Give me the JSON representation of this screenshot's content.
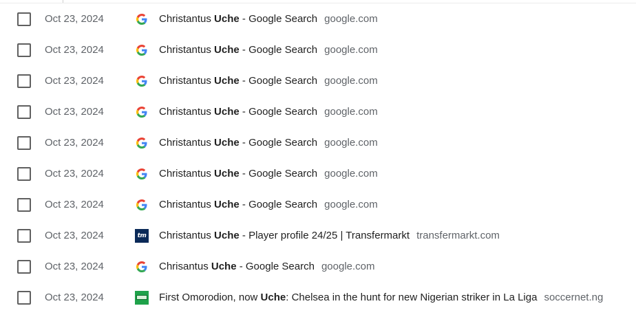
{
  "history": {
    "rows": [
      {
        "date": "Oct 23, 2024",
        "icon": "google-icon",
        "title_pre": "Christantus ",
        "title_hl": "Uche",
        "title_post": " - Google Search",
        "domain": "google.com"
      },
      {
        "date": "Oct 23, 2024",
        "icon": "google-icon",
        "title_pre": "Christantus ",
        "title_hl": "Uche",
        "title_post": " - Google Search",
        "domain": "google.com"
      },
      {
        "date": "Oct 23, 2024",
        "icon": "google-icon",
        "title_pre": "Christantus ",
        "title_hl": "Uche",
        "title_post": " - Google Search",
        "domain": "google.com"
      },
      {
        "date": "Oct 23, 2024",
        "icon": "google-icon",
        "title_pre": "Christantus ",
        "title_hl": "Uche",
        "title_post": " - Google Search",
        "domain": "google.com"
      },
      {
        "date": "Oct 23, 2024",
        "icon": "google-icon",
        "title_pre": "Christantus ",
        "title_hl": "Uche",
        "title_post": " - Google Search",
        "domain": "google.com"
      },
      {
        "date": "Oct 23, 2024",
        "icon": "google-icon",
        "title_pre": "Christantus ",
        "title_hl": "Uche",
        "title_post": " - Google Search",
        "domain": "google.com"
      },
      {
        "date": "Oct 23, 2024",
        "icon": "google-icon",
        "title_pre": "Christantus ",
        "title_hl": "Uche",
        "title_post": " - Google Search",
        "domain": "google.com"
      },
      {
        "date": "Oct 23, 2024",
        "icon": "transfermarkt-icon",
        "title_pre": "Christantus ",
        "title_hl": "Uche",
        "title_post": " - Player profile 24/25 | Transfermarkt",
        "domain": "transfermarkt.com"
      },
      {
        "date": "Oct 23, 2024",
        "icon": "google-icon",
        "title_pre": "Chrisantus ",
        "title_hl": "Uche",
        "title_post": " - Google Search",
        "domain": "google.com"
      },
      {
        "date": "Oct 23, 2024",
        "icon": "soccernet-icon",
        "title_pre": "First Omorodion, now ",
        "title_hl": "Uche",
        "title_post": ": Chelsea in the hunt for new Nigerian striker in La Liga",
        "domain": "soccernet.ng"
      }
    ],
    "colors": {
      "text": "#1f1f1f",
      "muted": "#5f6368",
      "checkbox_border": "#5f5f5f"
    }
  }
}
